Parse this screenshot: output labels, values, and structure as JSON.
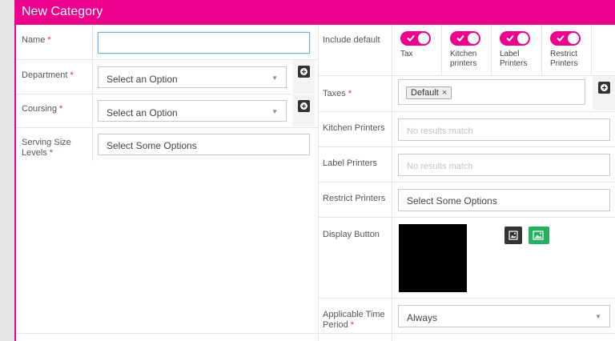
{
  "header": {
    "title": "New Category"
  },
  "required_mark": "*",
  "left_form": {
    "name": {
      "label": "Name",
      "value": ""
    },
    "department": {
      "label": "Department",
      "value": "Select an Option"
    },
    "coursing": {
      "label": "Coursing",
      "value": "Select an Option"
    },
    "serving_size": {
      "label": "Serving Size Levels",
      "value": "Select Some Options"
    }
  },
  "right_form": {
    "include_default": {
      "label": "Include default",
      "toggles": [
        {
          "label": "Tax",
          "on": true
        },
        {
          "label": "Kitchen printers",
          "on": true
        },
        {
          "label": "Label Printers",
          "on": true
        },
        {
          "label": "Restrict Printers",
          "on": true
        }
      ]
    },
    "taxes": {
      "label": "Taxes",
      "chip": "Default",
      "chip_remove": "×"
    },
    "kitchen_printers": {
      "label": "Kitchen Printers",
      "placeholder": "No results match"
    },
    "label_printers": {
      "label": "Label Printers",
      "placeholder": "No results match"
    },
    "restrict_printers": {
      "label": "Restrict Printers",
      "value": "Select Some Options"
    },
    "display_button": {
      "label": "Display Button",
      "preview_color": "#000000"
    },
    "time_period": {
      "label": "Applicable Time Period",
      "value": "Always"
    }
  },
  "colors": {
    "accent": "#ec008c",
    "green": "#27ae60",
    "dark": "#333333"
  }
}
